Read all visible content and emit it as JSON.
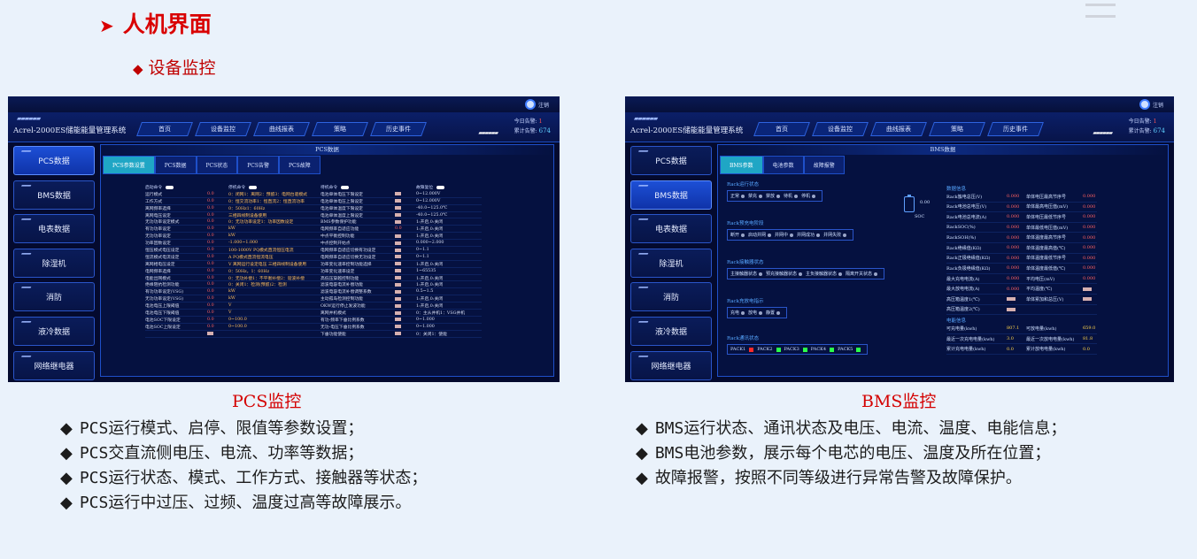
{
  "heading": "人机界面",
  "subheading": "设备监控",
  "app": {
    "title": "Acrel-2000ES储能能量管理系统",
    "user": "注销",
    "tabs": [
      "首页",
      "设备监控",
      "曲线报表",
      "策略",
      "历史事件"
    ],
    "alarm_today_label": "今日告警:",
    "alarm_today": "1",
    "alarm_total_label": "累计告警:",
    "alarm_total": "674",
    "sidebar": [
      "PCS数据",
      "BMS数据",
      "电表数据",
      "除湿机",
      "消防",
      "液冷数据",
      "网络继电器"
    ]
  },
  "pcs_screen": {
    "panel_title": "PCS数据",
    "tabs": [
      "PCS参数设置",
      "PCS数据",
      "PCS状态",
      "PCS告警",
      "PCS故障"
    ],
    "headers": [
      "启动命令",
      "停机命令",
      "待机命令",
      "故障复位"
    ],
    "rows": [
      [
        "运行模式",
        "0.0",
        "0：闭网1：离网2：预留3：电网台驱模式",
        "电池单体电压下限设定",
        "",
        "0~12.000V"
      ],
      [
        "工作方式",
        "0.0",
        "0：恒交流功率1：恒直流2：恒直流功率",
        "电池单体电压上限设定",
        "",
        "0~12.000V"
      ],
      [
        "离网频率选择",
        "0.0",
        "0：50Hz1：60Hz",
        "电池单体温度下限设定",
        "",
        "-40.0~125.0℃"
      ],
      [
        "离网电压设定",
        "0.0",
        "三相四线制设备使用",
        "电池单体温度上限设定",
        "",
        "-40.0~125.0℃"
      ],
      [
        "无功功率设定模式",
        "0.0",
        "0：无功功率设定1：功率因数设定",
        "BMS参数保护功能",
        "",
        "1:开启,0:关闭"
      ],
      [
        "有功功率设定",
        "0.0",
        "kW",
        "电网频率自适应功能",
        "0.0",
        "1:开启,0:关闭"
      ],
      [
        "无功功率设定",
        "0.0",
        "kW",
        "中点平衡控制功能",
        "",
        "1:开启,0:关闭"
      ],
      [
        "功率因数设定",
        "0.0",
        "-1.000~1.000",
        "中点控制开始点",
        "",
        "0.000~2.000"
      ],
      [
        "恒压模式电压设定",
        "0.0",
        "100-1000V PQ模式直流恒压电流",
        "电网频率自适应切换有功设定",
        "",
        "0~1.1"
      ],
      [
        "恒流模式电流设定",
        "0.0",
        "A  PQ模式直流恒流电压",
        "电网频率自适应切换无功设定",
        "",
        "0~1.1"
      ],
      [
        "离网相电压设定",
        "0.0",
        "V 离网运行设定电压 三相四线制设备使用",
        "功率变化速率控制功能选择",
        "",
        "1:开启,0:关闭"
      ],
      [
        "电网频率选择",
        "0.0",
        "0：50Hz，1：60Hz",
        "功率变化速率设定",
        "",
        "1~65535"
      ],
      [
        "电能出网模式",
        "0.0",
        "0：无功补偿1：不平衡补偿2：谐波补偿",
        "高低压穿越控制功能",
        "",
        "1:开启,0:关闭"
      ],
      [
        "绝缘阻抗检测功能",
        "0.0",
        "0：关闭1：检测(预留)2：检测",
        "滤波电容电流补偿功能",
        "",
        "1:开启,0:关闭"
      ],
      [
        "有功功率设定(VSG)",
        "0.0",
        "kW",
        "滤波电容电流补偿调整系数",
        "",
        "0.5~1.5"
      ],
      [
        "无功功率设定(VSG)",
        "0.0",
        "kW",
        "主动孤岛检测控制功能",
        "",
        "1:开启,0:关闭"
      ],
      [
        "电池电压上限阈值",
        "0.0",
        "V",
        "OKW运行停止发波功能",
        "",
        "1:开启,0:关闭"
      ],
      [
        "电池电压下限阈值",
        "0.0",
        "V",
        "离网并机模式",
        "",
        "0：主从并机1：VSG并机"
      ],
      [
        "电池SOC下限设定",
        "0.0",
        "0~100.0",
        "有功-频率下垂比例系数",
        "",
        "0~1.000"
      ],
      [
        "电池SOC上限设定",
        "0.0",
        "0~100.0",
        "无功-电压下垂比例系数",
        "",
        "0~1.000"
      ],
      [
        "",
        "",
        "",
        "下垂功能使能",
        "",
        "0：关闭1：使能"
      ]
    ]
  },
  "bms_screen": {
    "panel_title": "BMS数据",
    "tabs": [
      "BMS参数",
      "电池参数",
      "故障报警"
    ],
    "run_state_title": "Rack运行状态",
    "run_states": [
      "正常",
      "禁充",
      "禁放",
      "待机",
      "停机"
    ],
    "charge_stage_title": "Rack预充电阶段",
    "charge_stages": [
      "断开",
      "启动并网",
      "并网中",
      "并网成功",
      "并网失败"
    ],
    "contactor_title": "Rack接触器状态",
    "contactors": [
      "主接触器状态",
      "预充接触器状态",
      "主负接触器状态",
      "隔离开关状态"
    ],
    "charge_ind_title": "Rack充放电指示",
    "charge_ind": [
      "充电",
      "放电",
      "静置"
    ],
    "comm_title": "Rack通讯状态",
    "packs": [
      {
        "name": "PACK1",
        "color": "#ff2a2a"
      },
      {
        "name": "PACK2",
        "color": "#2bff4a"
      },
      {
        "name": "PACK3",
        "color": "#2bff4a"
      },
      {
        "name": "PACK4",
        "color": "#2bff4a"
      },
      {
        "name": "PACK5",
        "color": "#2bff4a"
      }
    ],
    "soc_label": "SOC",
    "soc_value": "0.00",
    "data_title": "数据信息",
    "data_rows": [
      [
        "Rack簇电总压(V)",
        "0.000",
        "单体电压最高节序号",
        "0.000"
      ],
      [
        "Rack电池总电压(V)",
        "0.000",
        "单体最高电压值(mV)",
        "0.000"
      ],
      [
        "Rack电池总电流(A)",
        "0.000",
        "单体电压最低节序号",
        "0.000"
      ],
      [
        "RackSOC(%)",
        "0.000",
        "单体最低电压值(mV)",
        "0.000"
      ],
      [
        "RackSOH(%)",
        "0.000",
        "单体温度最高节序号",
        "0.000"
      ],
      [
        "Rack绝缘值(KΩ)",
        "0.000",
        "单体温度最高值(℃)",
        "0.000"
      ],
      [
        "Rack正极绝缘值(KΩ)",
        "0.000",
        "单体温度最低节序号",
        "0.000"
      ],
      [
        "Rack负极绝缘值(KΩ)",
        "0.000",
        "单体温度最低值(℃)",
        "0.000"
      ],
      [
        "最大充电电流(A)",
        "0.000",
        "平均电压(mV)",
        "0.000"
      ],
      [
        "最大放电电流(A)",
        "0.000",
        "平均温度(℃)",
        ""
      ],
      [
        "高压箱温度1(℃)",
        "",
        "单体累加和总压(V)",
        ""
      ],
      [
        "高压箱温度2(℃)",
        "",
        "",
        ""
      ]
    ],
    "energy_title": "电能信息",
    "energy_rows": [
      [
        "可充电量(kwh)",
        "807.1",
        "可放电量(kwh)",
        "659.0"
      ],
      [
        "最近一次充电电量(kwh)",
        "3.0",
        "最近一次放电电量(kwh)",
        "81.8"
      ],
      [
        "累计充电电量(kwh)",
        "0.0",
        "累计放电电量(kwh)",
        "0.0"
      ]
    ]
  },
  "pcs_caption": "PCS监控",
  "bms_caption": "BMS监控",
  "pcs_bullets": [
    "PCS运行模式、启停、限值等参数设置；",
    "PCS交直流侧电压、电流、功率等数据；",
    "PCS运行状态、模式、工作方式、接触器等状态；",
    "PCS运行中过压、过频、温度过高等故障展示。"
  ],
  "bms_bullets": [
    "BMS运行状态、通讯状态及电压、电流、温度、电能信息；",
    "BMS电池参数，展示每个电芯的电压、温度及所在位置；",
    "故障报警，按照不同等级进行异常告警及故障保护。"
  ],
  "bullet_glyph": "◆",
  "colors": {
    "heading": "#d90000",
    "screen_bg": "#040a2e",
    "accent": "#1fa6c5",
    "active_side": "#1d4fd6"
  }
}
